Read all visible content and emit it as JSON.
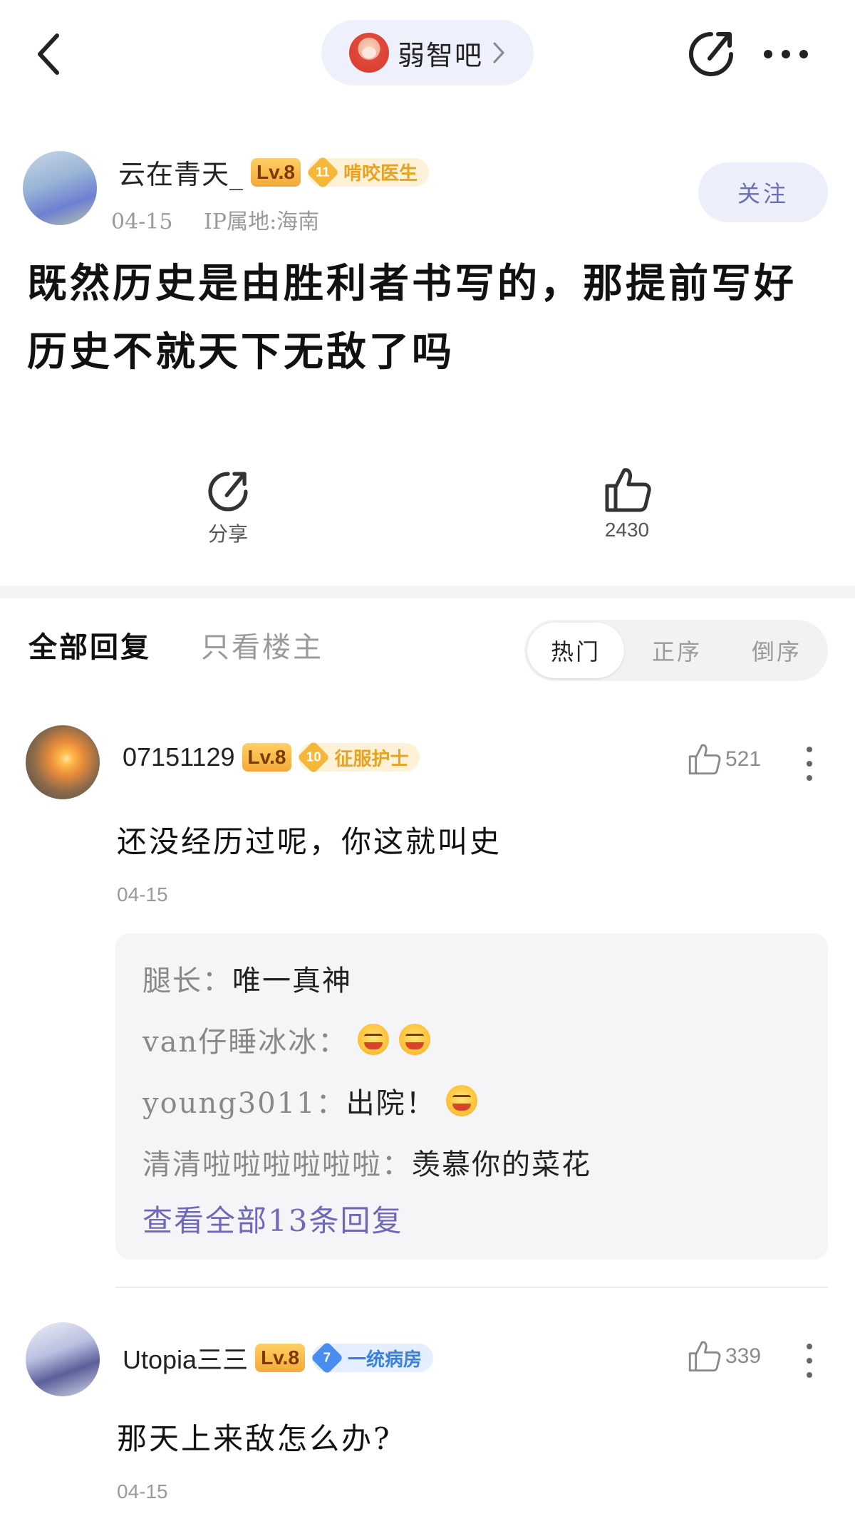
{
  "top_bar": {
    "forum_name": "弱智吧"
  },
  "post": {
    "author": "云在青天_",
    "author_level": "Lv.8",
    "badge_num": "11",
    "badge_title": "啃咬医生",
    "date": "04-15",
    "ip": "IP属地:海南",
    "follow_label": "关注",
    "title": "既然历史是由胜利者书写的，那提前写好历史不就天下无敌了吗",
    "share_label": "分享",
    "like_count": "2430"
  },
  "tabs": {
    "all": "全部回复",
    "op_only": "只看楼主",
    "sort": [
      "热门",
      "正序",
      "倒序"
    ]
  },
  "comments": [
    {
      "user": "07151129",
      "level": "Lv.8",
      "badge_num": "10",
      "badge_title": "征服护士",
      "likes": "521",
      "text": "还没经历过呢，你这就叫史",
      "date": "04-15",
      "replies": [
        {
          "user": "腿长：",
          "text": "唯一真神"
        },
        {
          "user": "van仔睡冰冰：",
          "text": ""
        },
        {
          "user": "young3011：",
          "text": "出院！"
        },
        {
          "user": "清清啦啦啦啦啦啦：",
          "text": "羡慕你的菜花"
        }
      ],
      "more_replies": "查看全部13条回复"
    },
    {
      "user": "Utopia三三",
      "level": "Lv.8",
      "badge_num": "7",
      "badge_title": "一统病房",
      "likes": "339",
      "text": "那天上来敌怎么办?",
      "date": "04-15"
    }
  ]
}
